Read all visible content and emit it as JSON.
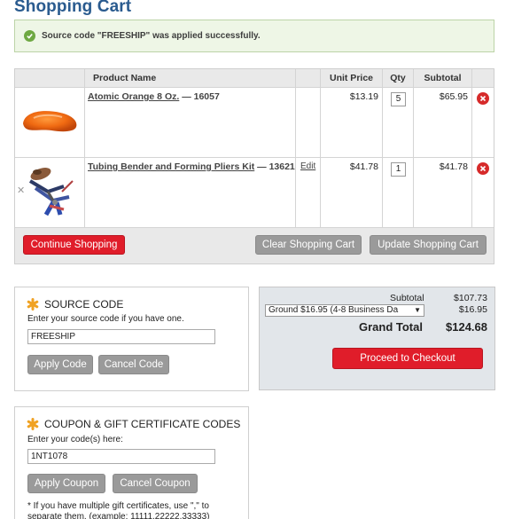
{
  "page": {
    "title": "Shopping Cart"
  },
  "message": {
    "text": "Source code \"FREESHIP\" was applied successfully."
  },
  "table": {
    "headers": {
      "name": "Product Name",
      "price": "Unit Price",
      "qty": "Qty",
      "subtotal": "Subtotal"
    },
    "rows": [
      {
        "name": "Atomic Orange 8 Oz.",
        "sku": " — 16057",
        "edit": "",
        "price": "$13.19",
        "qty": "5",
        "subtotal": "$65.95",
        "image": "orange-paint-swatch"
      },
      {
        "name": "Tubing Bender and Forming Pliers Kit",
        "sku": " — 13621",
        "edit": "Edit",
        "price": "$41.78",
        "qty": "1",
        "subtotal": "$41.78",
        "image": "pliers-kit"
      }
    ]
  },
  "actions": {
    "continue": "Continue Shopping",
    "clear": "Clear Shopping Cart",
    "update": "Update Shopping Cart"
  },
  "source_code": {
    "title": "SOURCE CODE",
    "hint": "Enter your source code if you have one.",
    "value": "FREESHIP",
    "apply": "Apply Code",
    "cancel": "Cancel Code"
  },
  "summary": {
    "subtotal_label": "Subtotal",
    "subtotal_value": "$107.73",
    "shipping_option": "Ground $16.95 (4-8 Business Da",
    "shipping_value": "$16.95",
    "grand_label": "Grand Total",
    "grand_value": "$124.68",
    "checkout": "Proceed to Checkout"
  },
  "coupon": {
    "title": "COUPON & GIFT CERTIFICATE CODES",
    "hint": "Enter your code(s) here:",
    "value": "1NT1078",
    "apply": "Apply Coupon",
    "cancel": "Cancel Coupon",
    "note": "* If you have multiple gift certificates, use \",\" to separate them. (example: 11111,22222,33333)"
  },
  "colors": {
    "accent": "#e01d2a",
    "title": "#2a5b8f",
    "success": "#6ea842"
  }
}
